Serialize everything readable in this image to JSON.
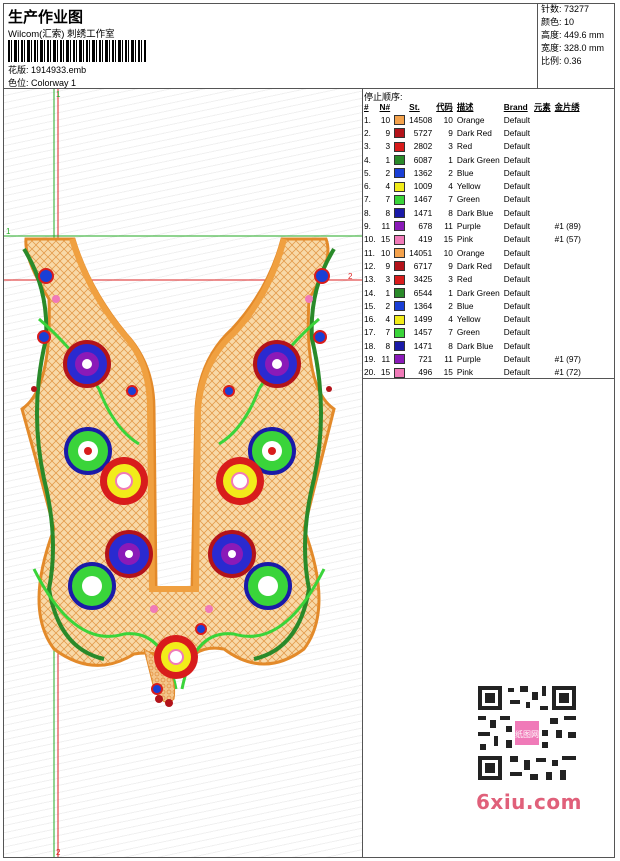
{
  "header": {
    "title": "生产作业图",
    "company": "Wilcom(汇索) 刺绣工作室",
    "design_label": "花版:",
    "design_value": "1914933.emb",
    "colorway_label": "色位:",
    "colorway_value": "Colorway 1"
  },
  "stats": [
    {
      "label": "针数:",
      "value": "73277"
    },
    {
      "label": "颜色:",
      "value": "10"
    },
    {
      "label": "高度:",
      "value": "449.6 mm"
    },
    {
      "label": "宽度:",
      "value": "328.0 mm"
    },
    {
      "label": "比例:",
      "value": "0.36"
    }
  ],
  "stop_sequence": {
    "title": "停止顺序:",
    "columns": [
      "#",
      "N#",
      "St.",
      "代码",
      "描述",
      "Brand",
      "元素",
      "金片绣"
    ],
    "rows": [
      [
        "1.",
        "10",
        "#f4a24c",
        "14508",
        "10",
        "Orange",
        "Default",
        ""
      ],
      [
        "2.",
        "9",
        "#b3131a",
        "5727",
        "9",
        "Dark Red",
        "Default",
        ""
      ],
      [
        "3.",
        "3",
        "#d81c1c",
        "2802",
        "3",
        "Red",
        "Default",
        ""
      ],
      [
        "4.",
        "1",
        "#2a8a2a",
        "6087",
        "1",
        "Dark Green",
        "Default",
        ""
      ],
      [
        "5.",
        "2",
        "#1a3fd6",
        "1362",
        "2",
        "Blue",
        "Default",
        ""
      ],
      [
        "6.",
        "4",
        "#f2ec1a",
        "1009",
        "4",
        "Yellow",
        "Default",
        ""
      ],
      [
        "7.",
        "7",
        "#3ad43a",
        "1467",
        "7",
        "Green",
        "Default",
        ""
      ],
      [
        "8.",
        "8",
        "#1a1aa8",
        "1471",
        "8",
        "Dark Blue",
        "Default",
        ""
      ],
      [
        "9.",
        "11",
        "#8a1ab8",
        "678",
        "11",
        "Purple",
        "Default",
        "#1 (89)"
      ],
      [
        "10.",
        "15",
        "#f07ab8",
        "419",
        "15",
        "Pink",
        "Default",
        "#1 (57)"
      ],
      [
        "11.",
        "10",
        "#f4a24c",
        "14051",
        "10",
        "Orange",
        "Default",
        ""
      ],
      [
        "12.",
        "9",
        "#b3131a",
        "6717",
        "9",
        "Dark Red",
        "Default",
        ""
      ],
      [
        "13.",
        "3",
        "#d81c1c",
        "3425",
        "3",
        "Red",
        "Default",
        ""
      ],
      [
        "14.",
        "1",
        "#2a8a2a",
        "6544",
        "1",
        "Dark Green",
        "Default",
        ""
      ],
      [
        "15.",
        "2",
        "#1a3fd6",
        "1364",
        "2",
        "Blue",
        "Default",
        ""
      ],
      [
        "16.",
        "4",
        "#f2ec1a",
        "1499",
        "4",
        "Yellow",
        "Default",
        ""
      ],
      [
        "17.",
        "7",
        "#3ad43a",
        "1457",
        "7",
        "Green",
        "Default",
        ""
      ],
      [
        "18.",
        "8",
        "#1a1aa8",
        "1471",
        "8",
        "Dark Blue",
        "Default",
        ""
      ],
      [
        "19.",
        "11",
        "#8a1ab8",
        "721",
        "11",
        "Purple",
        "Default",
        "#1 (97)"
      ],
      [
        "20.",
        "15",
        "#f07ab8",
        "496",
        "15",
        "Pink",
        "Default",
        "#1 (72)"
      ]
    ]
  },
  "guides": {
    "top_1": "1",
    "left_1": "1",
    "right_2": "2",
    "bottom_2": "2"
  },
  "watermark": "6xiu.com",
  "qr_badge": "纸图网"
}
